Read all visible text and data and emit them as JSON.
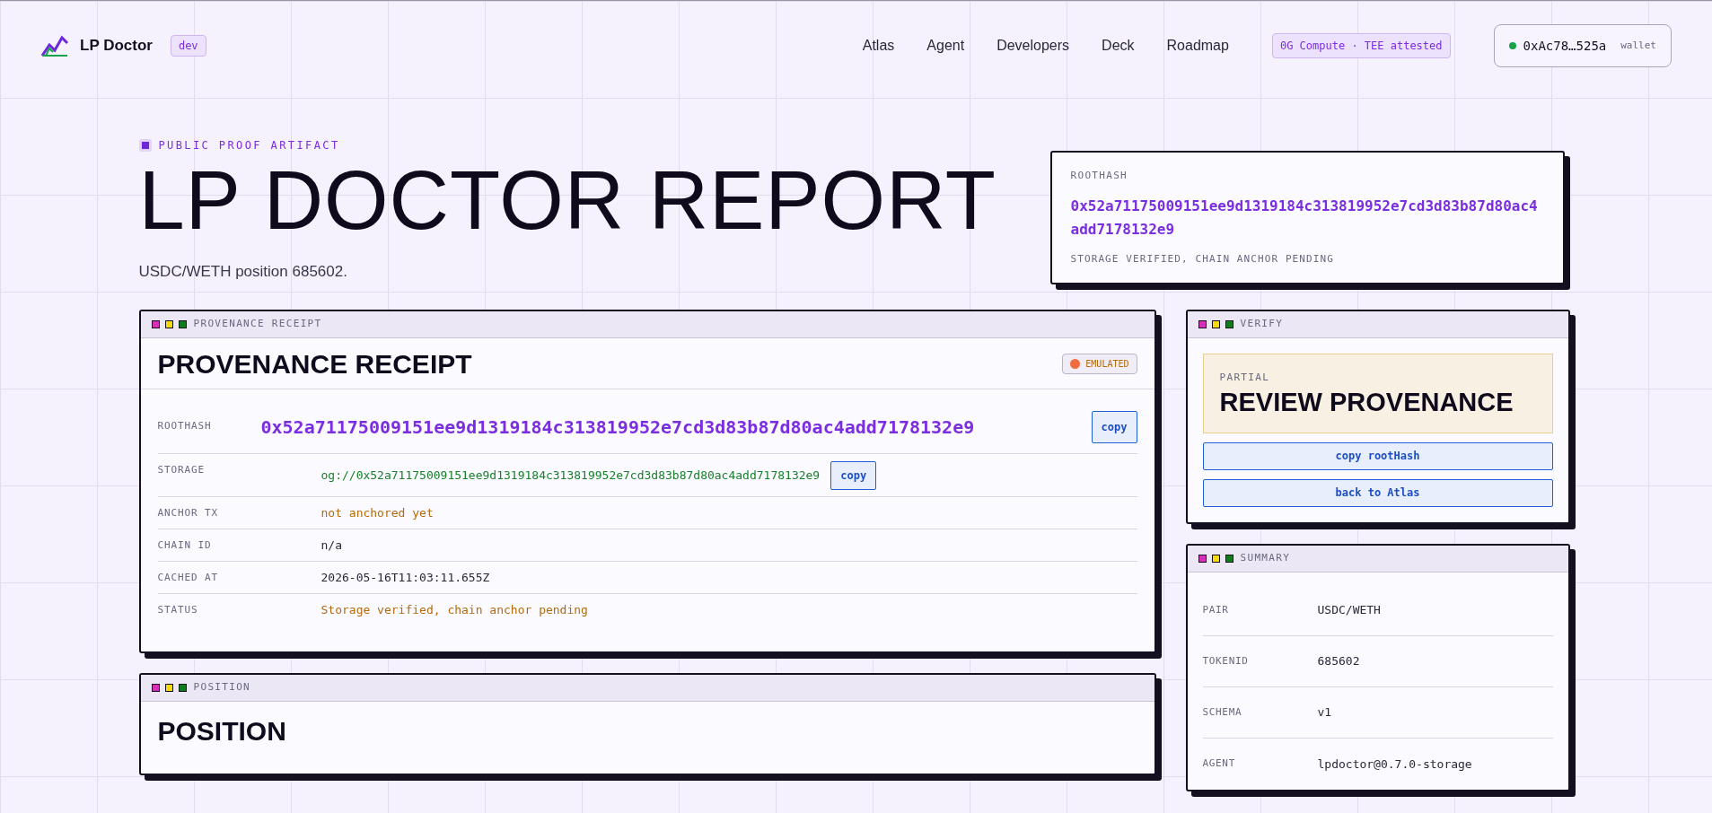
{
  "header": {
    "logo_text": "LP Doctor",
    "env_badge": "dev",
    "nav": [
      "Atlas",
      "Agent",
      "Developers",
      "Deck",
      "Roadmap"
    ],
    "compute_badge": "0G Compute · TEE attested",
    "wallet": {
      "address": "0xAc78…525a",
      "label": "wallet",
      "connected": true
    }
  },
  "hero": {
    "eyebrow": "PUBLIC PROOF ARTIFACT",
    "title": "LP DOCTOR REPORT",
    "subtitle": "USDC/WETH position 685602."
  },
  "roothash_card": {
    "label": "ROOTHASH",
    "value": "0x52a71175009151ee9d1319184c313819952e7cd3d83b87d80ac4add7178132e9",
    "status": "STORAGE VERIFIED, CHAIN ANCHOR PENDING"
  },
  "provenance": {
    "titlebar": "PROVENANCE RECEIPT",
    "heading": "PROVENANCE RECEIPT",
    "badge": "EMULATED",
    "rows": [
      {
        "label": "ROOTHASH",
        "value": "0x52a71175009151ee9d1319184c313819952e7cd3d83b87d80ac4add7178132e9",
        "kind": "hash",
        "copy": "copy"
      },
      {
        "label": "STORAGE",
        "value": "og://0x52a71175009151ee9d1319184c313819952e7cd3d83b87d80ac4add7178132e9",
        "kind": "ok",
        "copy": "copy"
      },
      {
        "label": "ANCHOR TX",
        "value": "not anchored yet",
        "kind": "warn"
      },
      {
        "label": "CHAIN ID",
        "value": "n/a",
        "kind": "plain"
      },
      {
        "label": "CACHED AT",
        "value": "2026-05-16T11:03:11.655Z",
        "kind": "plain"
      },
      {
        "label": "STATUS",
        "value": "Storage verified, chain anchor pending",
        "kind": "warn"
      }
    ]
  },
  "position": {
    "titlebar": "POSITION",
    "heading": "POSITION"
  },
  "verify": {
    "titlebar": "VERIFY",
    "verdict_level": "PARTIAL",
    "verdict": "REVIEW PROVENANCE",
    "buttons": [
      "copy rootHash",
      "back to Atlas"
    ]
  },
  "summary": {
    "titlebar": "SUMMARY",
    "rows": [
      {
        "label": "PAIR",
        "value": "USDC/WETH"
      },
      {
        "label": "TOKENID",
        "value": "685602"
      },
      {
        "label": "SCHEMA",
        "value": "v1"
      },
      {
        "label": "AGENT",
        "value": "lpdoctor@0.7.0-storage"
      }
    ]
  }
}
